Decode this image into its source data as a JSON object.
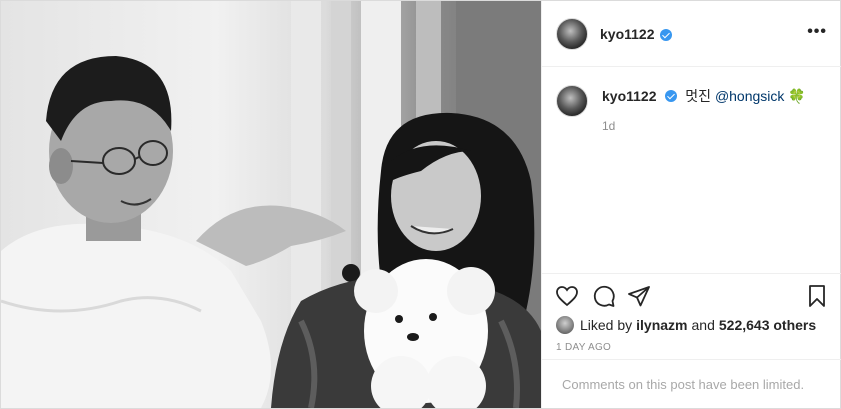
{
  "post": {
    "username": "kyo1122",
    "verified": true,
    "more_icon": "more-options-icon",
    "caption": {
      "username": "kyo1122",
      "text": "멋진",
      "mention": "@hongsick",
      "emoji": "🍀",
      "time": "1d"
    },
    "actions": {
      "like_icon": "heart-icon",
      "comment_icon": "comment-icon",
      "share_icon": "share-icon",
      "save_icon": "bookmark-icon"
    },
    "likes": {
      "prefix": "Liked by",
      "user": "ilynazm",
      "joiner": "and",
      "count": "522,643 others"
    },
    "posted_ago": "1 DAY AGO",
    "comments_notice": "Comments on this post have been limited."
  },
  "colors": {
    "verified": "#3897f0",
    "mention": "#00376b",
    "muted": "#8e8e8e",
    "border": "#dbdbdb"
  }
}
